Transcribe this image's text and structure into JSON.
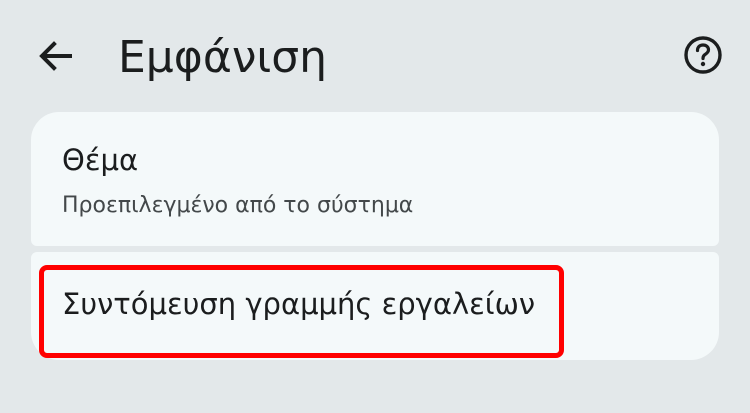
{
  "header": {
    "title": "Εμφάνιση",
    "back_icon": "arrow-left-icon",
    "help_icon": "help-circle-icon"
  },
  "settings": {
    "theme": {
      "title": "Θέμα",
      "subtitle": "Προεπιλεγμένο από το σύστημα"
    },
    "toolbar_shortcut": {
      "title": "Συντόμευση γραμμής εργαλείων"
    }
  },
  "colors": {
    "background": "#e3e8ea",
    "card": "#f4f9fa",
    "highlight": "#ff0000"
  }
}
